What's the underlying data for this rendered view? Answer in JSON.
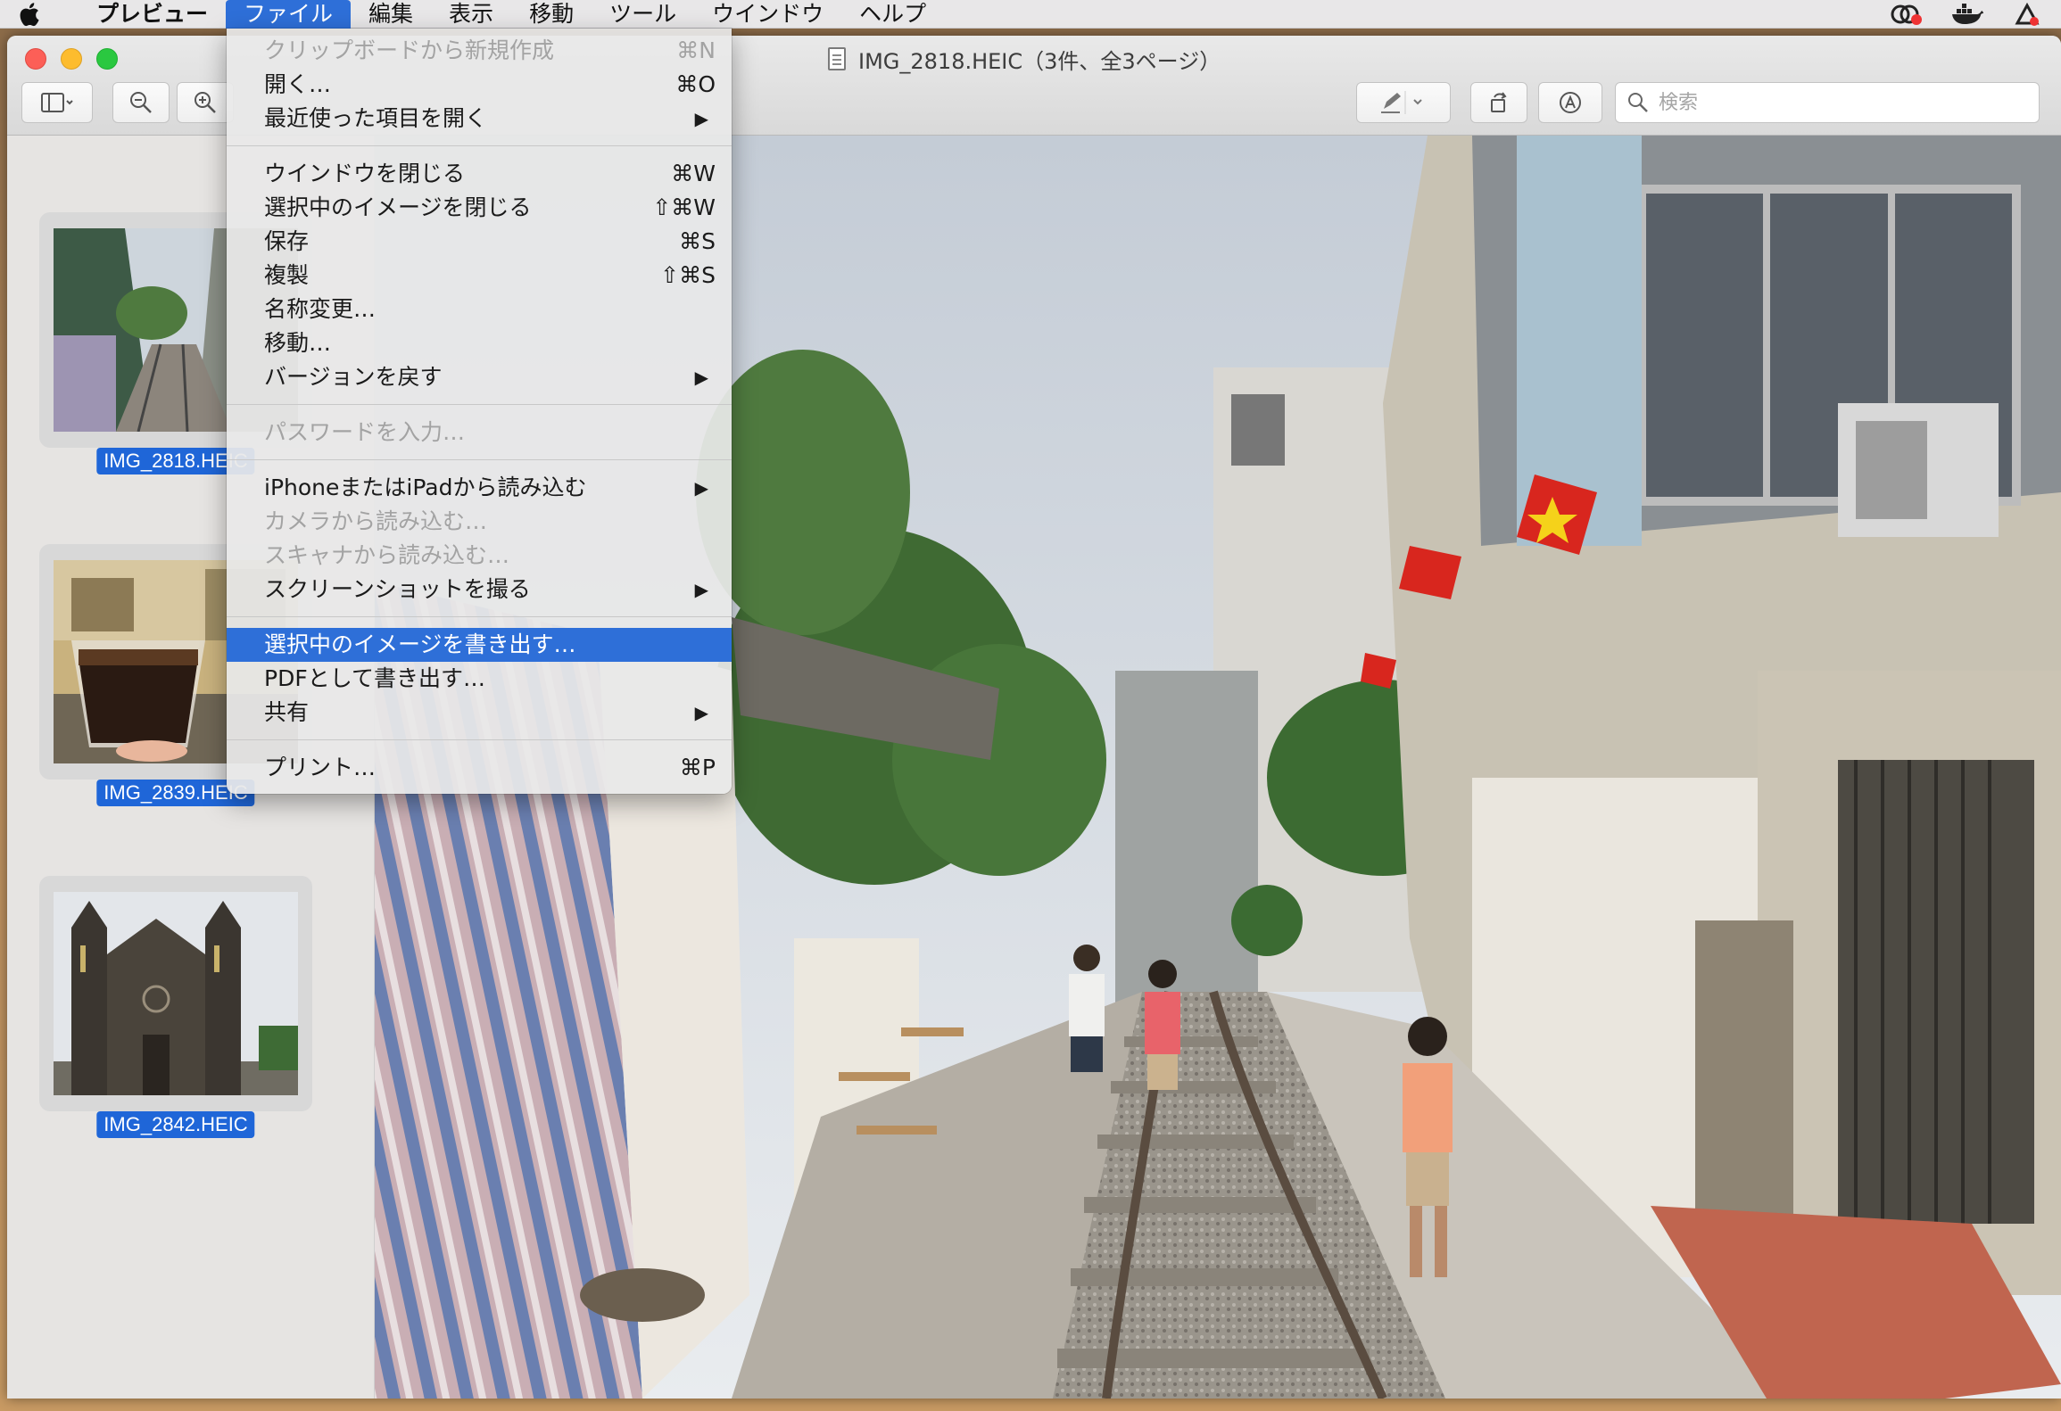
{
  "menubar": {
    "app_name": "プレビュー",
    "items": [
      "ファイル",
      "編集",
      "表示",
      "移動",
      "ツール",
      "ウインドウ",
      "ヘルプ"
    ],
    "active_item": "ファイル"
  },
  "window": {
    "title": "IMG_2818.HEIC（3件、全3ページ）"
  },
  "toolbar": {
    "search_placeholder": "検索"
  },
  "sidebar": {
    "thumbnails": [
      {
        "label": "IMG_2818.HEIC"
      },
      {
        "label": "IMG_2839.HEIC"
      },
      {
        "label": "IMG_2842.HEIC"
      }
    ]
  },
  "file_menu": {
    "groups": [
      [
        {
          "label": "クリップボードから新規作成",
          "shortcut": "⌘N",
          "disabled": true
        },
        {
          "label": "開く…",
          "shortcut": "⌘O"
        },
        {
          "label": "最近使った項目を開く",
          "submenu": true
        }
      ],
      [
        {
          "label": "ウインドウを閉じる",
          "shortcut": "⌘W"
        },
        {
          "label": "選択中のイメージを閉じる",
          "shortcut": "⇧⌘W"
        },
        {
          "label": "保存",
          "shortcut": "⌘S"
        },
        {
          "label": "複製",
          "shortcut": "⇧⌘S"
        },
        {
          "label": "名称変更…"
        },
        {
          "label": "移動…"
        },
        {
          "label": "バージョンを戻す",
          "submenu": true
        }
      ],
      [
        {
          "label": "パスワードを入力…",
          "disabled": true
        }
      ],
      [
        {
          "label": "iPhoneまたはiPadから読み込む",
          "submenu": true
        },
        {
          "label": "カメラから読み込む…",
          "disabled": true
        },
        {
          "label": "スキャナから読み込む…",
          "disabled": true
        },
        {
          "label": "スクリーンショットを撮る",
          "submenu": true
        }
      ],
      [
        {
          "label": "選択中のイメージを書き出す…",
          "highlighted": true
        },
        {
          "label": "PDFとして書き出す…"
        },
        {
          "label": "共有",
          "submenu": true
        }
      ],
      [
        {
          "label": "プリント…",
          "shortcut": "⌘P"
        }
      ]
    ]
  },
  "colors": {
    "selection_blue": "#2e6fd8",
    "label_blue": "#1f66d8"
  }
}
